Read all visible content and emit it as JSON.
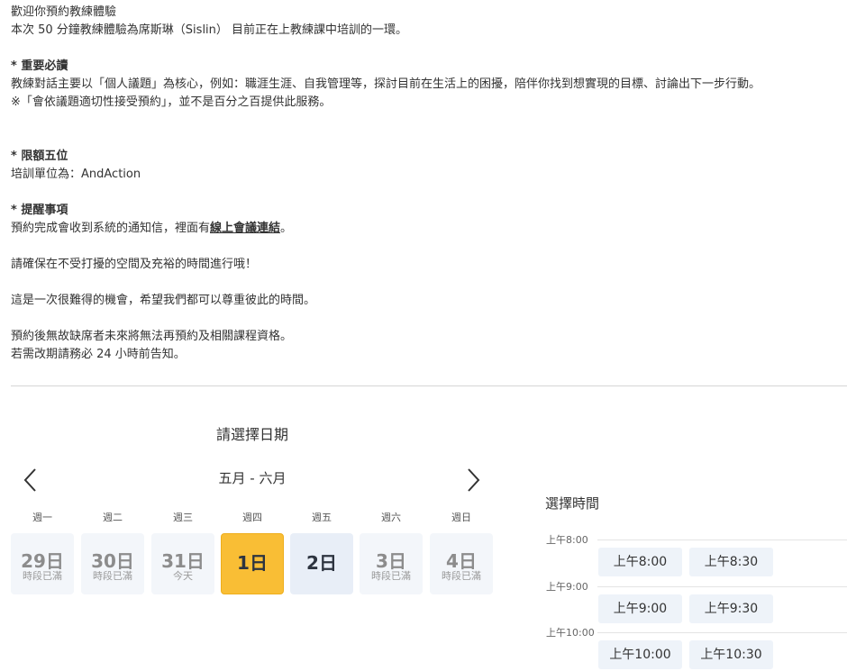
{
  "intro": {
    "line1": "歡迎你預約教練體驗",
    "line2": "本次 50 分鐘教練體驗為席斯琳（Sislin） 目前正在上教練課中培訓的一環。",
    "important_heading": " * 重要必讀",
    "important_text": "教練對話主要以「個人議題」為核心，例如：職涯生涯、自我管理等，探討目前在生活上的困擾，陪伴你找到想實現的目標、討論出下一步行動。",
    "important_note": "※「會依議題適切性接受預約」，並不是百分之百提供此服務。",
    "limit_heading": " * 限額五位",
    "limit_text": "培訓單位為：AndAction",
    "reminder_heading": " * 提醒事項",
    "reminder_text_before": "預約完成會收到系統的通知信，裡面有",
    "reminder_link": "線上會議連結",
    "reminder_text_after": "。",
    "note_quiet": "請確保在不受打擾的空間及充裕的時間進行哦！",
    "note_rare": "這是一次很難得的機會，希望我們都可以尊重彼此的時間。",
    "note_noshow": "預約後無故缺席者未來將無法再預約及相關課程資格。",
    "note_reschedule": "若需改期請務必 24 小時前告知。"
  },
  "calendar": {
    "title": "請選擇日期",
    "month_range": "五月 - 六月",
    "weekdays": [
      "週一",
      "週二",
      "週三",
      "週四",
      "週五",
      "週六",
      "週日"
    ],
    "days": [
      {
        "num": "29日",
        "status": "時段已滿",
        "state": "disabled"
      },
      {
        "num": "30日",
        "status": "時段已滿",
        "state": "disabled"
      },
      {
        "num": "31日",
        "status": "今天",
        "state": "disabled"
      },
      {
        "num": "1日",
        "status": "",
        "state": "selected"
      },
      {
        "num": "2日",
        "status": "",
        "state": "available"
      },
      {
        "num": "3日",
        "status": "時段已滿",
        "state": "disabled"
      },
      {
        "num": "4日",
        "status": "時段已滿",
        "state": "disabled"
      }
    ]
  },
  "time": {
    "title": "選擇時間",
    "groups": [
      {
        "label": "上午8:00",
        "slots": [
          "上午8:00",
          "上午8:30"
        ]
      },
      {
        "label": "上午9:00",
        "slots": [
          "上午9:00",
          "上午9:30"
        ]
      },
      {
        "label": "上午10:00",
        "slots": [
          "上午10:00",
          "上午10:30"
        ]
      }
    ]
  },
  "icons": {
    "prev": "chevron-left-icon",
    "next": "chevron-right-icon"
  }
}
